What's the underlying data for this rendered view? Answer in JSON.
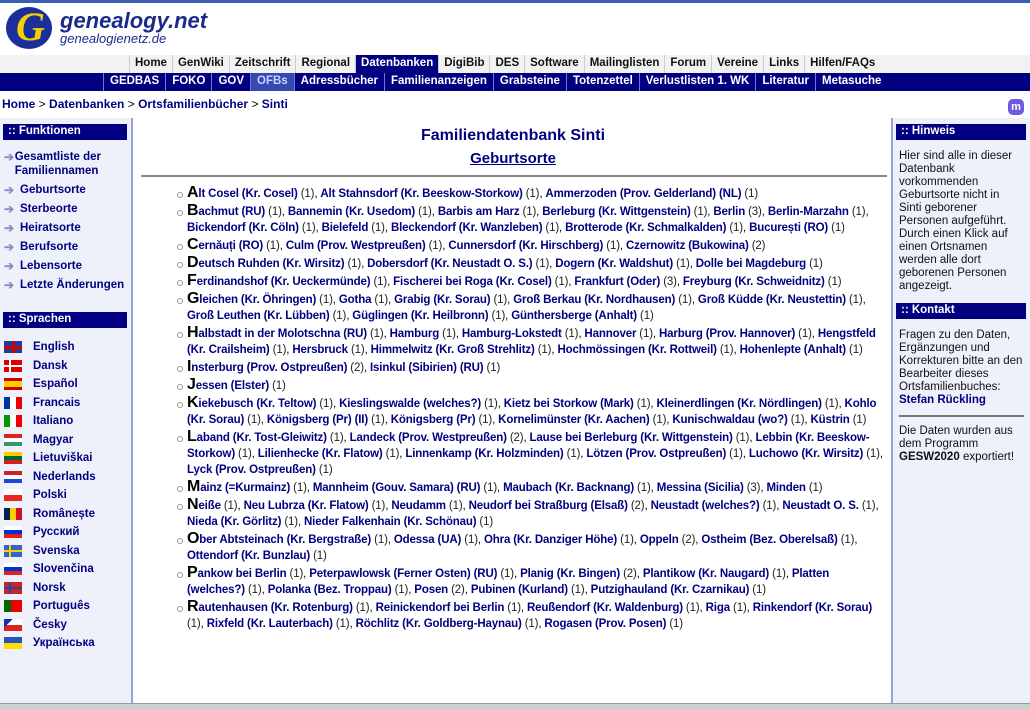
{
  "logo": {
    "title": "genealogy.net",
    "subtitle": "genealogienetz.de"
  },
  "nav_main": [
    "Home",
    "GenWiki",
    "Zeitschrift",
    "Regional",
    "Datenbanken",
    "DigiBib",
    "DES",
    "Software",
    "Mailinglisten",
    "Forum",
    "Vereine",
    "Links",
    "Hilfen/FAQs"
  ],
  "nav_main_active": "Datenbanken",
  "nav_sub": [
    "GEDBAS",
    "FOKO",
    "GOV",
    "OFBs",
    "Adressbücher",
    "Familienanzeigen",
    "Grabsteine",
    "Totenzettel",
    "Verlustlisten 1. WK",
    "Literatur",
    "Metasuche"
  ],
  "nav_sub_active": "OFBs",
  "breadcrumb": [
    "Home",
    "Datenbanken",
    "Ortsfamilienbücher",
    "Sinti"
  ],
  "mastodon_icon": "mastodon-icon",
  "left": {
    "funktionen_header": ":: Funktionen",
    "funktionen": [
      "Gesamtliste der Familiennamen",
      "Geburtsorte",
      "Sterbeorte",
      "Heiratsorte",
      "Berufsorte",
      "Lebensorte",
      "Letzte Änderungen"
    ],
    "sprachen_header": ":: Sprachen",
    "sprachen": [
      {
        "label": "English",
        "flag": "uk"
      },
      {
        "label": "Dansk",
        "flag": "dk"
      },
      {
        "label": "Español",
        "flag": "es"
      },
      {
        "label": "Francais",
        "flag": "fr"
      },
      {
        "label": "Italiano",
        "flag": "it"
      },
      {
        "label": "Magyar",
        "flag": "hu"
      },
      {
        "label": "Lietuviškai",
        "flag": "lt"
      },
      {
        "label": "Nederlands",
        "flag": "nl"
      },
      {
        "label": "Polski",
        "flag": "pl"
      },
      {
        "label": "Românește",
        "flag": "ro"
      },
      {
        "label": "Русский",
        "flag": "ru"
      },
      {
        "label": "Svenska",
        "flag": "se"
      },
      {
        "label": "Slovenčina",
        "flag": "sk"
      },
      {
        "label": "Norsk",
        "flag": "no"
      },
      {
        "label": "Português",
        "flag": "pt"
      },
      {
        "label": "Česky",
        "flag": "cz"
      },
      {
        "label": "Українська",
        "flag": "ua"
      }
    ]
  },
  "right": {
    "hinweis_header": ":: Hinweis",
    "hinweis_text": "Hier sind alle in dieser Datenbank vorkommenden Geburtsorte nicht in Sinti geborener Personen aufgeführt. Durch einen Klick auf einen Ortsnamen werden alle dort geborenen Personen angezeigt.",
    "kontakt_header": ":: Kontakt",
    "kontakt_text": "Fragen zu den Daten, Ergänzungen und Korrekturen bitte an den Bearbeiter dieses Ortsfamilienbuches:",
    "kontakt_name": "Stefan Rückling",
    "export_pre": "Die Daten wurden aus dem Programm",
    "export_program": "GESW2020",
    "export_post": "exportiert!"
  },
  "main": {
    "title": "Familiendatenbank Sinti",
    "subtitle": "Geburtsorte",
    "groups": [
      [
        [
          "Alt Cosel (Kr. Cosel)",
          1
        ],
        [
          "Alt Stahnsdorf (Kr. Beeskow-Storkow)",
          1
        ],
        [
          "Ammerzoden (Prov. Gelderland) (NL)",
          1
        ]
      ],
      [
        [
          "Bachmut (RU)",
          1
        ],
        [
          "Bannemin (Kr. Usedom)",
          1
        ],
        [
          "Barbis am Harz",
          1
        ],
        [
          "Berleburg (Kr. Wittgenstein)",
          1
        ],
        [
          "Berlin",
          3
        ],
        [
          "Berlin-Marzahn",
          1
        ],
        [
          "Bickendorf (Kr. Cöln)",
          1
        ],
        [
          "Bielefeld",
          1
        ],
        [
          "Bleckendorf (Kr. Wanzleben)",
          1
        ],
        [
          "Brotterode (Kr. Schmalkalden)",
          1
        ],
        [
          "București (RO)",
          1
        ]
      ],
      [
        [
          "Cernăuți (RO)",
          1
        ],
        [
          "Culm (Prov. Westpreußen)",
          1
        ],
        [
          "Cunnersdorf (Kr. Hirschberg)",
          1
        ],
        [
          "Czernowitz (Bukowina)",
          2
        ]
      ],
      [
        [
          "Deutsch Ruhden (Kr. Wirsitz)",
          1
        ],
        [
          "Dobersdorf (Kr. Neustadt O. S.)",
          1
        ],
        [
          "Dogern (Kr. Waldshut)",
          1
        ],
        [
          "Dolle bei Magdeburg",
          1
        ]
      ],
      [
        [
          "Ferdinandshof (Kr. Ueckermünde)",
          1
        ],
        [
          "Fischerei bei Roga (Kr. Cosel)",
          1
        ],
        [
          "Frankfurt (Oder)",
          3
        ],
        [
          "Freyburg (Kr. Schweidnitz)",
          1
        ]
      ],
      [
        [
          "Gleichen (Kr. Öhringen)",
          1
        ],
        [
          "Gotha",
          1
        ],
        [
          "Grabig (Kr. Sorau)",
          1
        ],
        [
          "Groß Berkau (Kr. Nordhausen)",
          1
        ],
        [
          "Groß Küdde (Kr. Neustettin)",
          1
        ],
        [
          "Groß Leuthen (Kr. Lübben)",
          1
        ],
        [
          "Güglingen (Kr. Heilbronn)",
          1
        ],
        [
          "Günthersberge (Anhalt)",
          1
        ]
      ],
      [
        [
          "Halbstadt in der Molotschna (RU)",
          1
        ],
        [
          "Hamburg",
          1
        ],
        [
          "Hamburg-Lokstedt",
          1
        ],
        [
          "Hannover",
          1
        ],
        [
          "Harburg (Prov. Hannover)",
          1
        ],
        [
          "Hengstfeld (Kr. Crailsheim)",
          1
        ],
        [
          "Hersbruck",
          1
        ],
        [
          "Himmelwitz (Kr. Groß Strehlitz)",
          1
        ],
        [
          "Hochmössingen (Kr. Rottweil)",
          1
        ],
        [
          "Hohenlepte (Anhalt)",
          1
        ]
      ],
      [
        [
          "Insterburg (Prov. Ostpreußen)",
          2
        ],
        [
          "Isinkul (Sibirien) (RU)",
          1
        ]
      ],
      [
        [
          "Jessen (Elster)",
          1
        ]
      ],
      [
        [
          "Kiekebusch (Kr. Teltow)",
          1
        ],
        [
          "Kieslingswalde (welches?)",
          1
        ],
        [
          "Kietz bei Storkow (Mark)",
          1
        ],
        [
          "Kleinerdlingen (Kr. Nördlingen)",
          1
        ],
        [
          "Kohlo (Kr. Sorau)",
          1
        ],
        [
          "Königsberg (Pr) (II)",
          1
        ],
        [
          "Königsberg (Pr)",
          1
        ],
        [
          "Kornelimünster (Kr. Aachen)",
          1
        ],
        [
          "Kunischwaldau (wo?)",
          1
        ],
        [
          "Küstrin",
          1
        ]
      ],
      [
        [
          "Laband (Kr. Tost-Gleiwitz)",
          1
        ],
        [
          "Landeck (Prov. Westpreußen)",
          2
        ],
        [
          "Lause bei Berleburg (Kr. Wittgenstein)",
          1
        ],
        [
          "Lebbin (Kr. Beeskow-Storkow)",
          1
        ],
        [
          "Lilienhecke (Kr. Flatow)",
          1
        ],
        [
          "Linnenkamp (Kr. Holzminden)",
          1
        ],
        [
          "Lötzen (Prov. Ostpreußen)",
          1
        ],
        [
          "Luchowo (Kr. Wirsitz)",
          1
        ],
        [
          "Lyck (Prov. Ostpreußen)",
          1
        ]
      ],
      [
        [
          "Mainz (=Kurmainz)",
          1
        ],
        [
          "Mannheim (Gouv. Samara) (RU)",
          1
        ],
        [
          "Maubach (Kr. Backnang)",
          1
        ],
        [
          "Messina (Sicilia)",
          3
        ],
        [
          "Minden",
          1
        ]
      ],
      [
        [
          "Neiße",
          1
        ],
        [
          "Neu Lubrza (Kr. Flatow)",
          1
        ],
        [
          "Neudamm",
          1
        ],
        [
          "Neudorf bei Straßburg (Elsaß)",
          2
        ],
        [
          "Neustadt (welches?)",
          1
        ],
        [
          "Neustadt O. S.",
          1
        ],
        [
          "Nieda (Kr. Görlitz)",
          1
        ],
        [
          "Nieder Falkenhain (Kr. Schönau)",
          1
        ]
      ],
      [
        [
          "Ober Abtsteinach (Kr. Bergstraße)",
          1
        ],
        [
          "Odessa (UA)",
          1
        ],
        [
          "Ohra (Kr. Danziger Höhe)",
          1
        ],
        [
          "Oppeln",
          2
        ],
        [
          "Ostheim (Bez. Oberelsaß)",
          1
        ],
        [
          "Ottendorf (Kr. Bunzlau)",
          1
        ]
      ],
      [
        [
          "Pankow bei Berlin",
          1
        ],
        [
          "Peterpawlowsk (Ferner Osten) (RU)",
          1
        ],
        [
          "Planig (Kr. Bingen)",
          2
        ],
        [
          "Plantikow (Kr. Naugard)",
          1
        ],
        [
          "Platten (welches?)",
          1
        ],
        [
          "Polanka (Bez. Troppau)",
          1
        ],
        [
          "Posen",
          2
        ],
        [
          "Pubinen (Kurland)",
          1
        ],
        [
          "Putzighauland (Kr. Czarnikau)",
          1
        ]
      ],
      [
        [
          "Rautenhausen (Kr. Rotenburg)",
          1
        ],
        [
          "Reinickendorf bei Berlin",
          1
        ],
        [
          "Reußendorf (Kr. Waldenburg)",
          1
        ],
        [
          "Riga",
          1
        ],
        [
          "Rinkendorf (Kr. Sorau)",
          1
        ],
        [
          "Rixfeld (Kr. Lauterbach)",
          1
        ],
        [
          "Röchlitz (Kr. Goldberg-Haynau)",
          1
        ],
        [
          "Rogasen (Prov. Posen)",
          1
        ]
      ]
    ]
  },
  "colors": {
    "navy": "#000080",
    "sidebar_bg": "#eef0fa",
    "nav_gray": "#f2f2f2"
  }
}
